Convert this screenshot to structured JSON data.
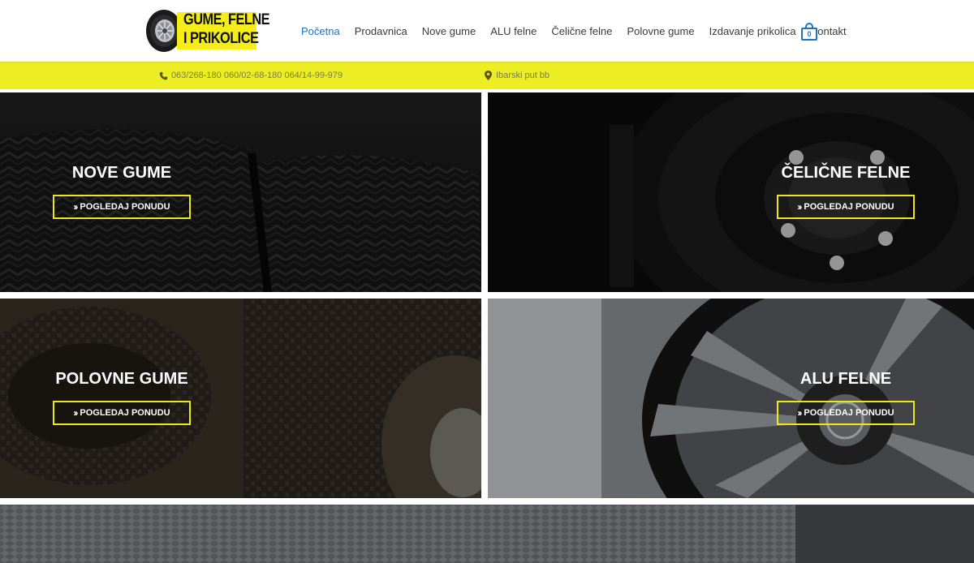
{
  "header": {
    "logo": {
      "lines": [
        "GUME, FELNE",
        "I PRIKOLICE"
      ]
    },
    "nav": [
      {
        "label": "Početna",
        "active": true
      },
      {
        "label": "Prodavnica"
      },
      {
        "label": "Nove gume"
      },
      {
        "label": "ALU felne"
      },
      {
        "label": "Čelične felne"
      },
      {
        "label": "Polovne gume"
      },
      {
        "label": "Izdavanje prikolica"
      },
      {
        "label": "Kontakt"
      }
    ],
    "cart": {
      "count": "0",
      "icon": "shopping-bag-icon"
    }
  },
  "topbar": {
    "phone": "063/268-180 060/02-68-180 064/14-99-979",
    "address": "Ibarski put bb",
    "phone_icon": "phone-icon",
    "address_icon": "map-marker-icon"
  },
  "tiles": [
    {
      "title": "NOVE GUME",
      "button": "POGLEDAJ PONUDU"
    },
    {
      "title": "ČELIČNE FELNE",
      "button": "POGLEDAJ PONUDU"
    },
    {
      "title": "POLOVNE GUME",
      "button": "POGLEDAJ PONUDU"
    },
    {
      "title": "ALU FELNE",
      "button": "POGLEDAJ PONUDU"
    }
  ],
  "colors": {
    "accent": "#1e73be",
    "topbar": "#eded24",
    "button_border": "#f0e61c",
    "logo_yellow": "#f5ec1c"
  }
}
